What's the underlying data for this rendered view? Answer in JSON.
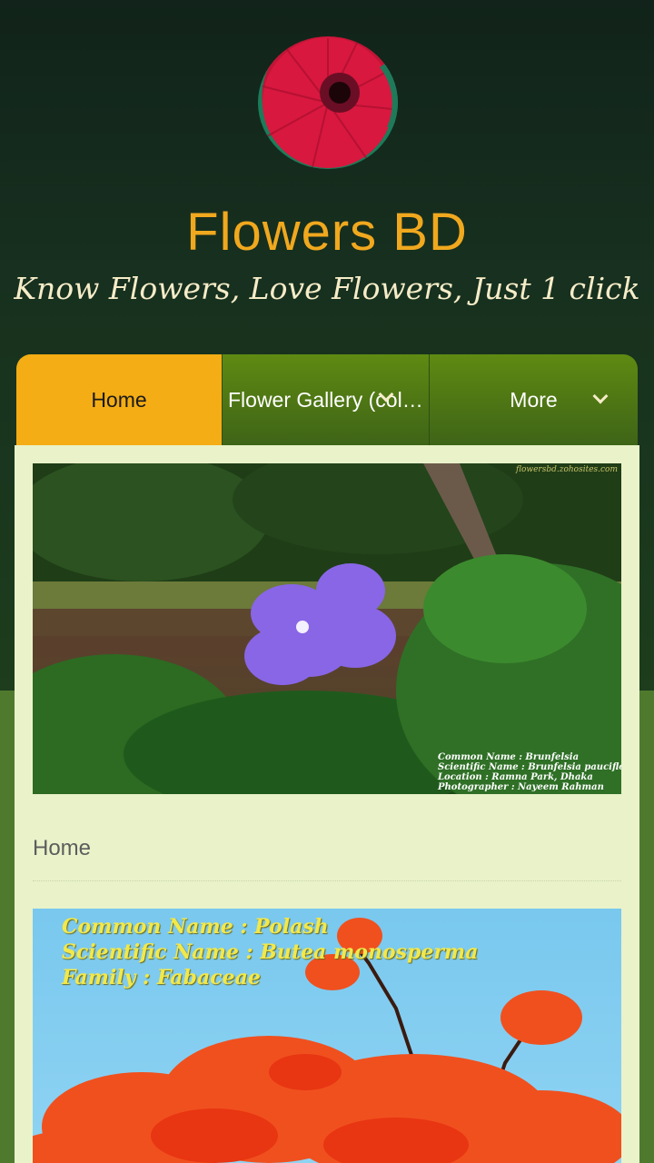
{
  "header": {
    "site_title": "Flowers BD",
    "tagline": "Know Flowers, Love Flowers, Just 1 click",
    "logo_icon": "red-gerbera-flower-logo"
  },
  "nav": {
    "items": [
      {
        "label": "Home",
        "active": true
      },
      {
        "label": "Flower Gallery (col…",
        "has_dropdown": true
      },
      {
        "label": "More",
        "has_dropdown": true
      }
    ]
  },
  "main": {
    "featured_photo": {
      "watermark": "flowersbd.zohosites.com",
      "caption": [
        "Common Name : Brunfelsia",
        "Scientific Name : Brunfelsia pauciflora",
        "Location : Ramna Park, Dhaka",
        "Photographer : Nayeem Rahman"
      ]
    },
    "page_heading": "Home",
    "second_photo": {
      "caption": [
        "Common Name : Polash",
        "Scientific Name : Butea monosperma",
        "Family : Fabaceae"
      ]
    }
  },
  "colors": {
    "accent": "#f4ad14",
    "title": "#f0a81e",
    "nav_green": "#4e7515",
    "content_bg": "#e9f2c9"
  }
}
